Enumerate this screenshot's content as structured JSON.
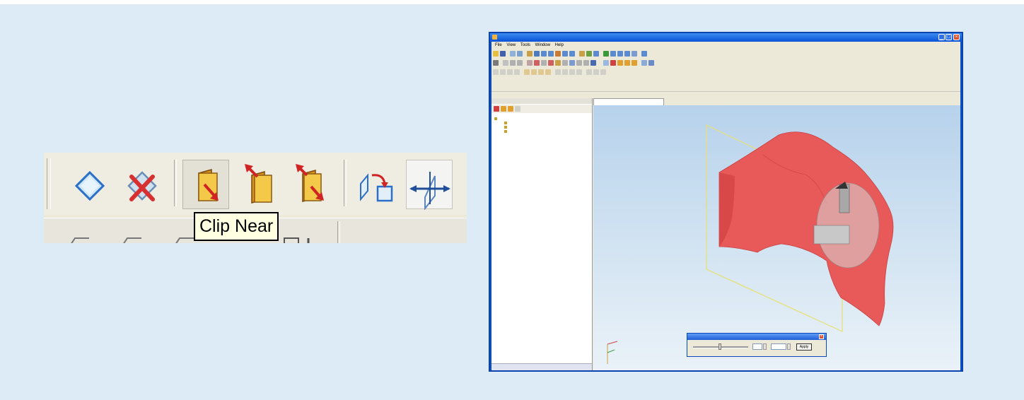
{
  "tooltip": {
    "text": "Clip Near"
  },
  "zoom_toolbar": {
    "buttons": [
      "clip-plane-show",
      "clip-plane-delete",
      "clip-near",
      "clip-far",
      "clip-slab",
      "clip-plane-flip",
      "clip-plane-align"
    ]
  },
  "colors": {
    "background": "#dcebf6",
    "clip_icon_fill": "#f0c040",
    "clip_icon_arrow": "#d02424",
    "model_red": "#e85a5a",
    "clip_plane": "#e8e070"
  },
  "app_window": {
    "title": "",
    "menu": [
      "File",
      "View",
      "Tools",
      "Window",
      "Help"
    ],
    "tree": {
      "root": "",
      "children": [
        "",
        "",
        ""
      ]
    },
    "document_tab": "",
    "clip_dialog": {
      "title": "",
      "field_1": "",
      "field_2": "",
      "apply_label": "Apply"
    }
  }
}
